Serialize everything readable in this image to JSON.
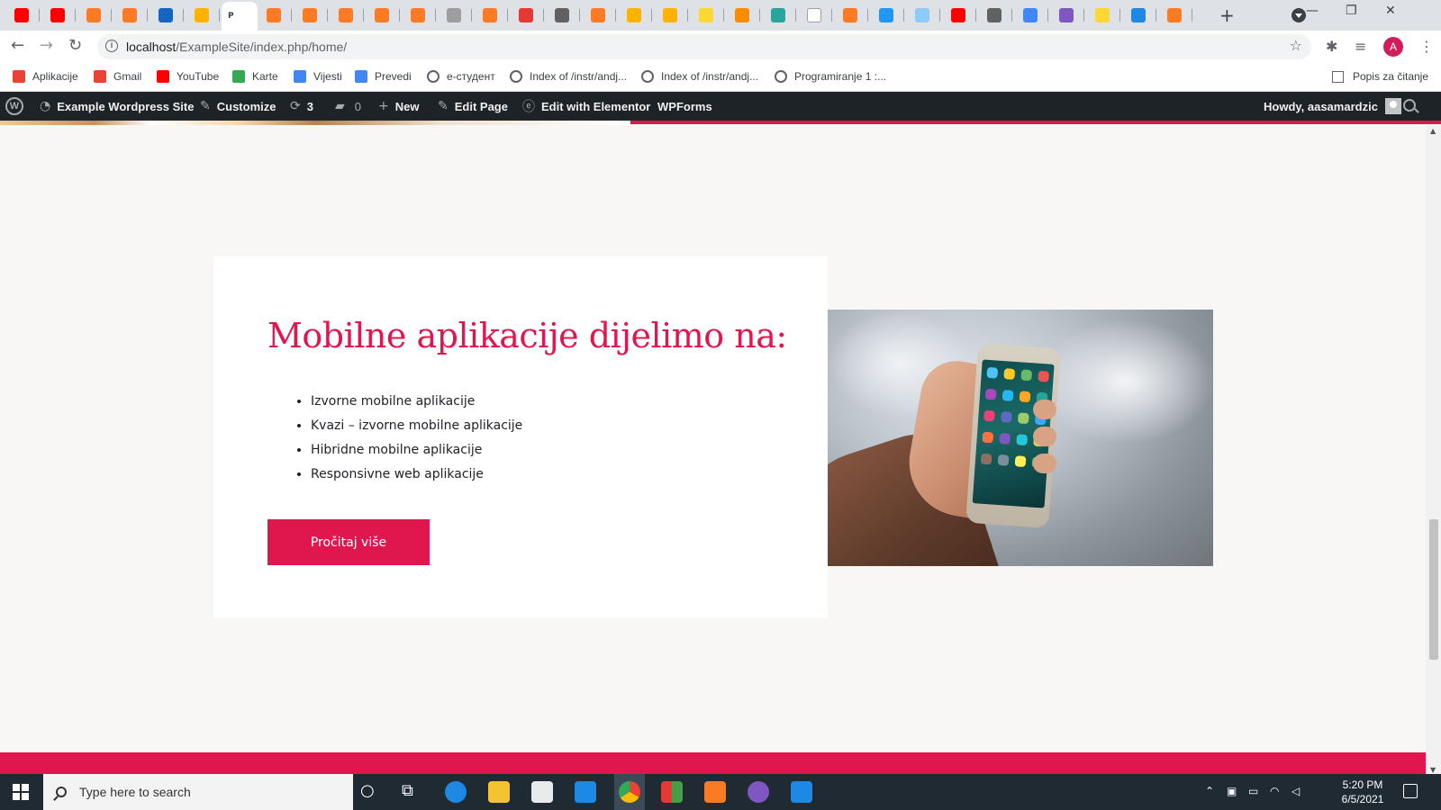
{
  "browser": {
    "url_host": "localhost",
    "url_path": "/ExampleSite/index.php/home/",
    "active_tab_label": "P",
    "tab_colors": [
      "#ff0000",
      "#ff0000",
      "#fb7a24",
      "#fb7a24",
      "#1565c0",
      "#ffb300",
      "#ffffff",
      "#fb7a24",
      "#fb7a24",
      "#fb7a24",
      "#fb7a24",
      "#fb7a24",
      "#9e9e9e",
      "#fb7a24",
      "#e53935",
      "#616161",
      "#fb7a24",
      "#ffb300",
      "#ffb300",
      "#fdd835",
      "#fb8c00",
      "#26a69a",
      "#ffffff",
      "#fb7a24",
      "#2196f3",
      "#90caf9",
      "#ff0000",
      "#616161",
      "#4285f4",
      "#7e57c2",
      "#fdd835",
      "#1e88e5",
      "#fb7a24"
    ],
    "profile_initial": "A"
  },
  "bookmarks": {
    "items": [
      {
        "label": "Aplikacije",
        "icon": "apps-grid-icon",
        "color": "#ea4335"
      },
      {
        "label": "Gmail",
        "icon": "gmail-icon",
        "color": "#ea4335"
      },
      {
        "label": "YouTube",
        "icon": "youtube-icon",
        "color": "#ff0000"
      },
      {
        "label": "Karte",
        "icon": "maps-icon",
        "color": "#34a853"
      },
      {
        "label": "Vijesti",
        "icon": "news-icon",
        "color": "#4285f4"
      },
      {
        "label": "Prevedi",
        "icon": "translate-icon",
        "color": "#4285f4"
      },
      {
        "label": "e-студент",
        "icon": "globe-icon",
        "color": ""
      },
      {
        "label": "Index of /instr/andj...",
        "icon": "globe-icon",
        "color": ""
      },
      {
        "label": "Index of /instr/andj...",
        "icon": "globe-icon",
        "color": ""
      },
      {
        "label": "Programiranje 1 :...",
        "icon": "globe-icon",
        "color": ""
      }
    ],
    "reading_list": "Popis za čitanje"
  },
  "adminbar": {
    "site_name": "Example Wordpress Site",
    "customize": "Customize",
    "updates_count": "3",
    "comments_count": "0",
    "new": "New",
    "edit_page": "Edit Page",
    "edit_elementor": "Edit with Elementor",
    "wpforms": "WPForms",
    "howdy": "Howdy, aasamardzic"
  },
  "section": {
    "heading": "Mobilne aplikacije dijelimo na:",
    "list": [
      "Izvorne mobilne aplikacije",
      "Kvazi – izvorne mobilne aplikacije",
      "Hibridne mobilne aplikacije",
      "Responsivne web aplikacije"
    ],
    "button_label": "Pročitaj više",
    "accent_color": "#e0174f"
  },
  "taskbar": {
    "search_placeholder": "Type here to search",
    "time": "5:20 PM",
    "date": "6/5/2021"
  }
}
